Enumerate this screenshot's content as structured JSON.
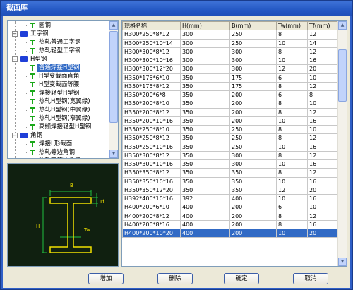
{
  "window": {
    "title": "截面库"
  },
  "tree": {
    "items": [
      {
        "label": "圆钢",
        "icon": "t-section-icon",
        "depth": 1,
        "selected": false
      },
      {
        "label": "工字钢",
        "icon": "folder-icon",
        "depth": 0,
        "expanded": true,
        "selected": false
      },
      {
        "label": "热轧普通工字钢",
        "icon": "t-section-icon",
        "depth": 1,
        "selected": false
      },
      {
        "label": "热轧轻型工字钢",
        "icon": "t-section-icon",
        "depth": 1,
        "selected": false
      },
      {
        "label": "H型钢",
        "icon": "folder-icon",
        "depth": 0,
        "expanded": true,
        "selected": false
      },
      {
        "label": "普通焊接H型钢",
        "icon": "t-section-icon",
        "depth": 1,
        "selected": true
      },
      {
        "label": "H型变截面直角",
        "icon": "t-section-icon",
        "depth": 1,
        "selected": false
      },
      {
        "label": "H型变截面等腰",
        "icon": "t-section-icon",
        "depth": 1,
        "selected": false
      },
      {
        "label": "焊接轻型H型钢",
        "icon": "t-section-icon",
        "depth": 1,
        "selected": false
      },
      {
        "label": "热轧H型钢(宽翼缘)",
        "icon": "t-section-icon",
        "depth": 1,
        "selected": false
      },
      {
        "label": "热轧H型钢(中翼缘)",
        "icon": "t-section-icon",
        "depth": 1,
        "selected": false
      },
      {
        "label": "热轧H型钢(窄翼缘)",
        "icon": "t-section-icon",
        "depth": 1,
        "selected": false
      },
      {
        "label": "高频焊接轻型H型钢",
        "icon": "t-section-icon",
        "depth": 1,
        "selected": false
      },
      {
        "label": "角钢",
        "icon": "folder-icon",
        "depth": 0,
        "expanded": true,
        "selected": false
      },
      {
        "label": "焊接L形截面",
        "icon": "t-section-icon",
        "depth": 1,
        "selected": false
      },
      {
        "label": "热轧等边角钢",
        "icon": "t-section-icon",
        "depth": 1,
        "selected": false
      },
      {
        "label": "热轧不等边角钢",
        "icon": "t-section-icon",
        "depth": 1,
        "selected": false
      }
    ]
  },
  "preview": {
    "labels": {
      "B": "B",
      "Tf": "Tf",
      "H": "H",
      "Tw": "Tw"
    },
    "colors": {
      "background": "#102010",
      "section": "#f0e000",
      "dimension": "#1fbf3f",
      "text": "#f0e000"
    }
  },
  "grid": {
    "columns": [
      "规格名称",
      "H(mm)",
      "B(mm)",
      "Tw(mm)",
      "Tf(mm)"
    ],
    "rows": [
      [
        "H300*250*8*12",
        "300",
        "250",
        "8",
        "12"
      ],
      [
        "H300*250*10*14",
        "300",
        "250",
        "10",
        "14"
      ],
      [
        "H300*300*8*12",
        "300",
        "300",
        "8",
        "12"
      ],
      [
        "H300*300*10*16",
        "300",
        "300",
        "10",
        "16"
      ],
      [
        "H300*300*12*20",
        "300",
        "300",
        "12",
        "20"
      ],
      [
        "H350*175*6*10",
        "350",
        "175",
        "6",
        "10"
      ],
      [
        "H350*175*8*12",
        "350",
        "175",
        "8",
        "12"
      ],
      [
        "H350*200*6*8",
        "350",
        "200",
        "6",
        "8"
      ],
      [
        "H350*200*8*10",
        "350",
        "200",
        "8",
        "10"
      ],
      [
        "H350*200*8*12",
        "350",
        "200",
        "8",
        "12"
      ],
      [
        "H350*200*10*16",
        "350",
        "200",
        "10",
        "16"
      ],
      [
        "H350*250*8*10",
        "350",
        "250",
        "8",
        "10"
      ],
      [
        "H350*250*8*12",
        "350",
        "250",
        "8",
        "12"
      ],
      [
        "H350*250*10*16",
        "350",
        "250",
        "10",
        "16"
      ],
      [
        "H350*300*8*12",
        "350",
        "300",
        "8",
        "12"
      ],
      [
        "H350*300*10*16",
        "350",
        "300",
        "10",
        "16"
      ],
      [
        "H350*350*8*12",
        "350",
        "350",
        "8",
        "12"
      ],
      [
        "H350*350*10*16",
        "350",
        "350",
        "10",
        "16"
      ],
      [
        "H350*350*12*20",
        "350",
        "350",
        "12",
        "20"
      ],
      [
        "H392*400*10*16",
        "392",
        "400",
        "10",
        "16"
      ],
      [
        "H400*200*6*10",
        "400",
        "200",
        "6",
        "10"
      ],
      [
        "H400*200*8*12",
        "400",
        "200",
        "8",
        "12"
      ],
      [
        "H400*200*8*16",
        "400",
        "200",
        "8",
        "16"
      ],
      [
        "H400*200*10*20",
        "400",
        "200",
        "10",
        "20"
      ]
    ],
    "selected_row": 23
  },
  "buttons": {
    "add": "增加",
    "delete": "删除",
    "ok": "确定",
    "cancel": "取消"
  }
}
